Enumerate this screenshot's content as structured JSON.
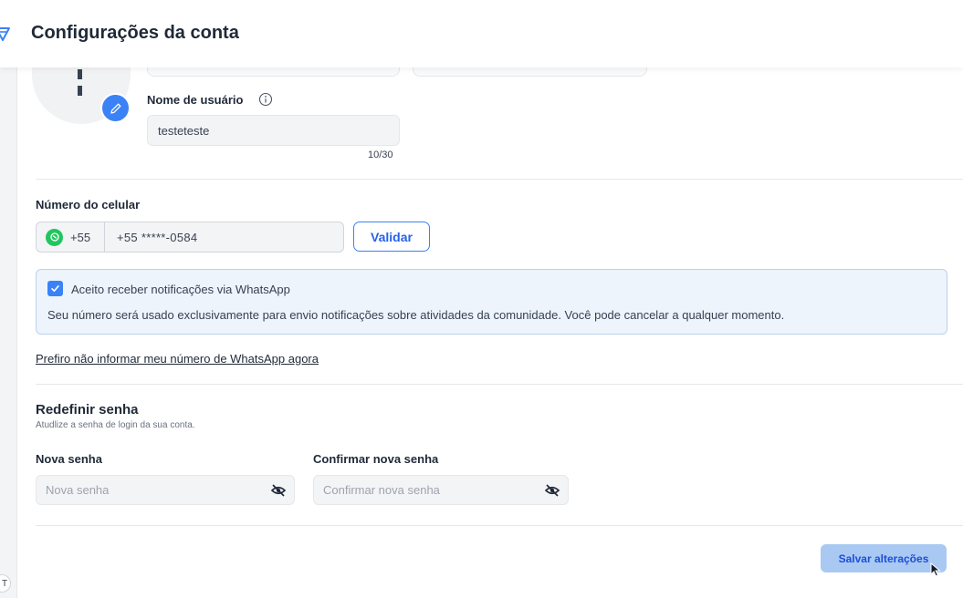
{
  "header": {
    "title": "Configurações da conta",
    "brand_icon": "feather-logo-icon",
    "brand_color": "#3b82f6"
  },
  "profile": {
    "avatar_icon": "avatar-placeholder-icon",
    "edit_icon": "pencil-icon",
    "username_label": "Nome de usuário",
    "username_value": "testeteste",
    "username_counter": "10/30"
  },
  "phone": {
    "label": "Número do celular",
    "country_code": "+55",
    "number_value": "+55 *****-0584",
    "validate_label": "Validar",
    "prefix_icon": "whatsapp-icon"
  },
  "whatsapp_notice": {
    "checkbox_label": "Aceito receber notificações via WhatsApp",
    "checked": true,
    "description": "Seu número será usado exclusivamente para envio notificações sobre atividades da comunidade. Você pode cancelar a qualquer momento.",
    "skip_link": "Prefiro não informar meu número de WhatsApp agora"
  },
  "password": {
    "title": "Redefinir senha",
    "subtitle": "Atudlize a senha de login da sua conta.",
    "new_label": "Nova senha",
    "new_placeholder": "Nova senha",
    "confirm_label": "Confirmar nova senha",
    "confirm_placeholder": "Confirmar nova senha",
    "toggle_icon": "eye-slash-icon"
  },
  "footer": {
    "save_label": "Salvar alterações",
    "bottom_badge": "T"
  },
  "colors": {
    "accent": "#3b82f6",
    "notice_bg": "#eef4fc",
    "save_bg": "#a9c9f2"
  }
}
